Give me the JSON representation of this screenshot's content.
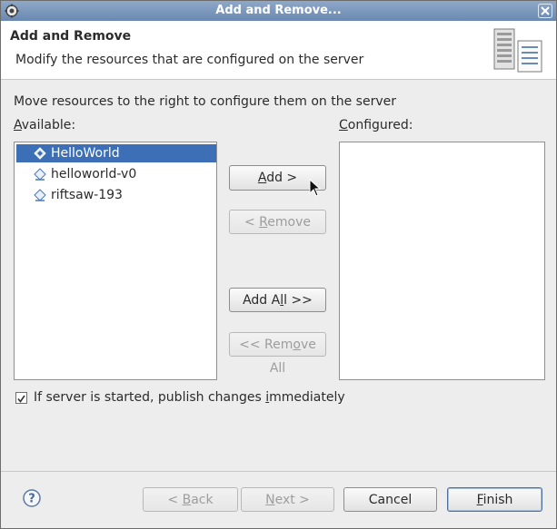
{
  "window": {
    "title": "Add and Remove..."
  },
  "header": {
    "title": "Add and Remove",
    "description": "Modify the resources that are configured on the server",
    "image_icon": "server-config-icon"
  },
  "instructions": "Move resources to the right to configure them on the server",
  "available": {
    "label_mnemonic": "A",
    "label_rest": "vailable:",
    "items": [
      {
        "label": "HelloWorld",
        "selected": true,
        "icon": "module-icon"
      },
      {
        "label": "helloworld-v0",
        "selected": false,
        "icon": "module-icon"
      },
      {
        "label": "riftsaw-193",
        "selected": false,
        "icon": "module-icon"
      }
    ]
  },
  "configured": {
    "label_mnemonic": "C",
    "label_rest": "onfigured:",
    "items": []
  },
  "buttons": {
    "add": {
      "pre": "",
      "mn": "A",
      "post": "dd >"
    },
    "remove": {
      "pre": "< ",
      "mn": "R",
      "post": "emove"
    },
    "add_all": {
      "pre": "Add A",
      "mn": "l",
      "post": "l >>"
    },
    "remove_all": {
      "pre": "<< Rem",
      "mn": "o",
      "post": "ve All"
    }
  },
  "publish": {
    "checked": true,
    "pre": "If server is started, publish changes ",
    "mn": "i",
    "post": "mmediately"
  },
  "footer": {
    "back": {
      "pre": "< ",
      "mn": "B",
      "post": "ack"
    },
    "next": {
      "pre": "",
      "mn": "N",
      "post": "ext >"
    },
    "cancel": "Cancel",
    "finish": {
      "pre": "",
      "mn": "F",
      "post": "inish"
    }
  }
}
